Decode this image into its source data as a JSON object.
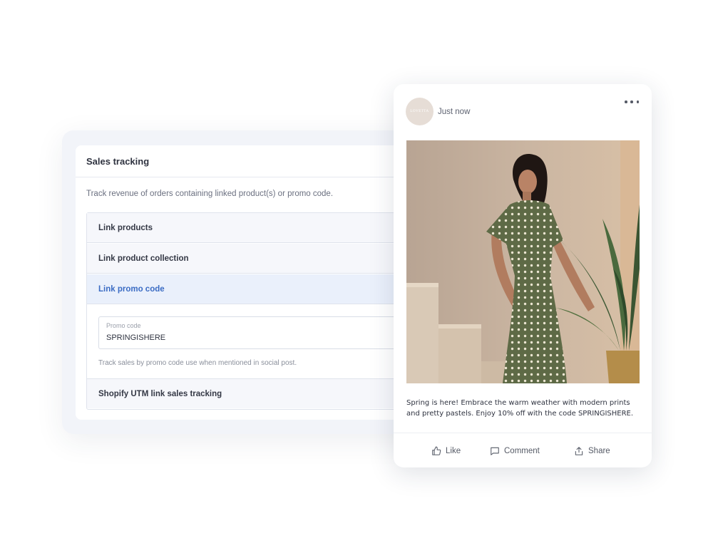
{
  "sales_tracking": {
    "title": "Sales tracking",
    "description": "Track revenue of orders containing linked product(s) or promo code.",
    "sections": {
      "link_products": "Link products",
      "link_collection": "Link product collection",
      "link_promo": "Link promo code",
      "utm": "Shopify UTM link sales tracking"
    },
    "promo_field": {
      "label": "Promo code",
      "value": "SPRINGISHERE"
    },
    "promo_help": "Track sales by promo code use when mentioned in social post.",
    "active_section": "Link promo code",
    "colors": {
      "active_text": "#3b6cc4",
      "active_bg": "#eaf0fb"
    }
  },
  "post": {
    "avatar_text": "LOVETTA",
    "time": "Just now",
    "caption": "Spring is here! Embrace the warm weather with modern prints and pretty pastels. Enjoy 10% off with the code SPRINGISHERE.",
    "actions": {
      "like": "Like",
      "comment": "Comment",
      "share": "Share"
    },
    "icons": [
      "more-horizontal-icon",
      "thumbs-up-icon",
      "comment-icon",
      "share-icon"
    ]
  }
}
